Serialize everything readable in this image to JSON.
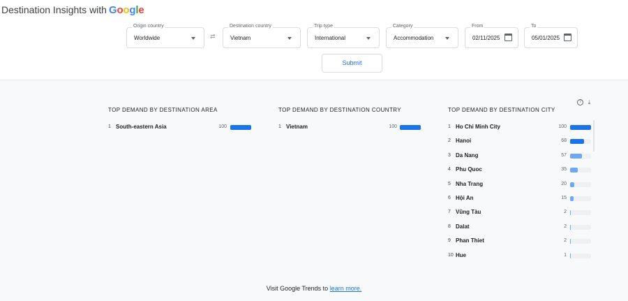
{
  "header": {
    "brand_text": "Destination Insights with",
    "brand_logo": [
      "G",
      "o",
      "o",
      "g",
      "l",
      "e"
    ]
  },
  "filters": {
    "origin": {
      "label": "Origin country",
      "value": "Worldwide"
    },
    "destination": {
      "label": "Destination country",
      "value": "Vietnam"
    },
    "trip_type": {
      "label": "Trip type",
      "value": "International"
    },
    "category": {
      "label": "Category",
      "value": "Accommodation"
    },
    "from": {
      "label": "From",
      "value": "02/11/2025"
    },
    "to": {
      "label": "To",
      "value": "05/01/2025"
    },
    "swap_icon": "swap-arrows-icon",
    "submit_label": "Submit"
  },
  "colors": {
    "bar_dark": "#1a73e8",
    "bar_light": "#6fa8f0",
    "track": "#eef0f2"
  },
  "area": {
    "title": "TOP DEMAND BY DESTINATION AREA",
    "items": [
      {
        "rank": "1",
        "name": "South-eastern Asia",
        "value": 100
      }
    ]
  },
  "country": {
    "title": "TOP DEMAND BY DESTINATION COUNTRY",
    "items": [
      {
        "rank": "1",
        "name": "Vietnam",
        "value": 100
      }
    ]
  },
  "city": {
    "title": "TOP DEMAND BY DESTINATION CITY",
    "icons": [
      "help-icon",
      "download-icon"
    ],
    "items": [
      {
        "rank": "1",
        "name": "Ho Chi Minh City",
        "value": 100
      },
      {
        "rank": "2",
        "name": "Hanoi",
        "value": 68
      },
      {
        "rank": "3",
        "name": "Da Nang",
        "value": 57
      },
      {
        "rank": "4",
        "name": "Phu Quoc",
        "value": 35
      },
      {
        "rank": "5",
        "name": "Nha Trang",
        "value": 20
      },
      {
        "rank": "6",
        "name": "Hội An",
        "value": 15
      },
      {
        "rank": "7",
        "name": "Vũng Tàu",
        "value": 2
      },
      {
        "rank": "8",
        "name": "Dalat",
        "value": 2
      },
      {
        "rank": "9",
        "name": "Phan Thiet",
        "value": 2
      },
      {
        "rank": "10",
        "name": "Hue",
        "value": 1
      }
    ]
  },
  "footer": {
    "text": "Visit Google Trends to",
    "link": "learn more."
  }
}
